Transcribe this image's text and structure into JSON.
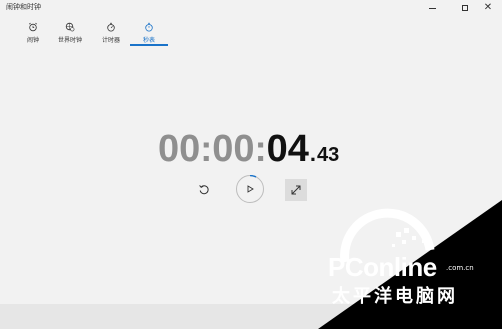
{
  "window": {
    "title": "闹钟和时钟",
    "controls": {
      "minimize_icon": "minimize-icon",
      "maximize_icon": "maximize-icon",
      "close_icon": "close-icon"
    }
  },
  "tabs": [
    {
      "label": "闹钟",
      "icon": "alarm-icon",
      "active": false
    },
    {
      "label": "世界时钟",
      "icon": "world-clock-icon",
      "active": false
    },
    {
      "label": "计时器",
      "icon": "timer-icon",
      "active": false
    },
    {
      "label": "秒表",
      "icon": "stopwatch-icon",
      "active": true
    }
  ],
  "stopwatch": {
    "hours": "00",
    "sep1": ":",
    "minutes": "00",
    "sep2": ":",
    "seconds": "04",
    "dot": ".",
    "hundredths": "43",
    "buttons": {
      "reset": "reset-icon",
      "play": "play-icon",
      "expand": "expand-icon"
    }
  },
  "watermark": {
    "brand": "PConline",
    "domain": ".com.cn",
    "chinese": "太平洋电脑网"
  },
  "colors": {
    "accent": "#1a73c9",
    "background": "#f2f2f2",
    "digits_dim": "#8f8f8f",
    "digits_bright": "#111111"
  }
}
